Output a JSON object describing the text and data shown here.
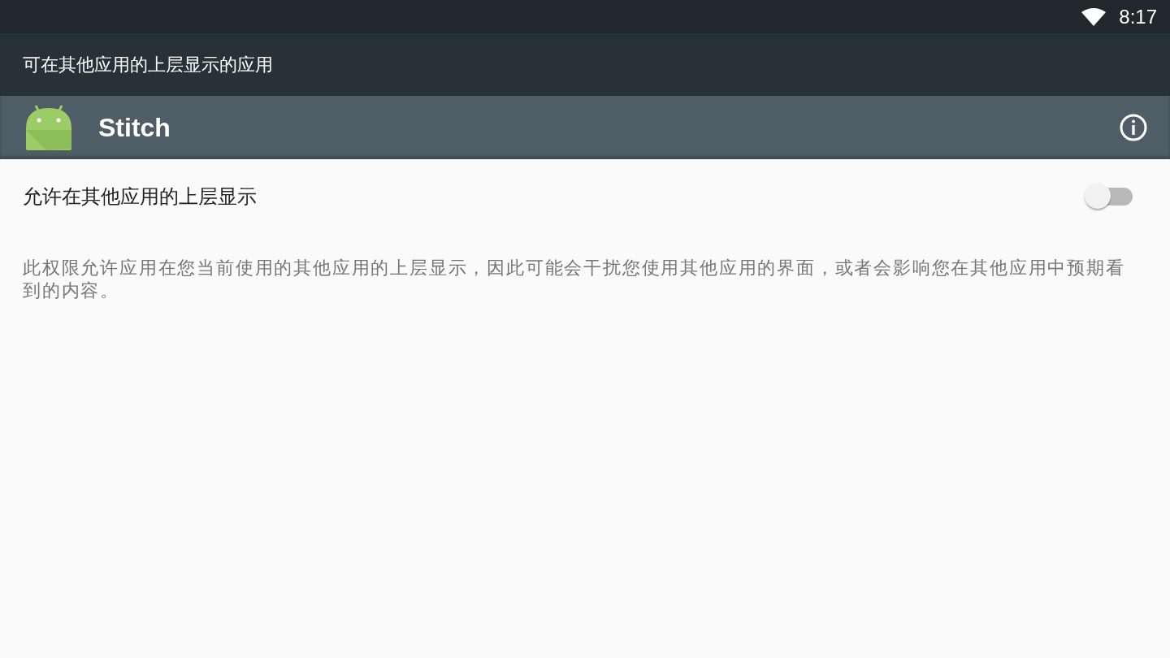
{
  "status_bar": {
    "time": "8:17"
  },
  "toolbar": {
    "title": "可在其他应用的上层显示的应用"
  },
  "app_header": {
    "name": "Stitch"
  },
  "setting": {
    "label": "允许在其他应用的上层显示",
    "on": false
  },
  "description": "此权限允许应用在您当前使用的其他应用的上层显示，因此可能会干扰您使用其他应用的界面，或者会影响您在其他应用中预期看到的内容。"
}
